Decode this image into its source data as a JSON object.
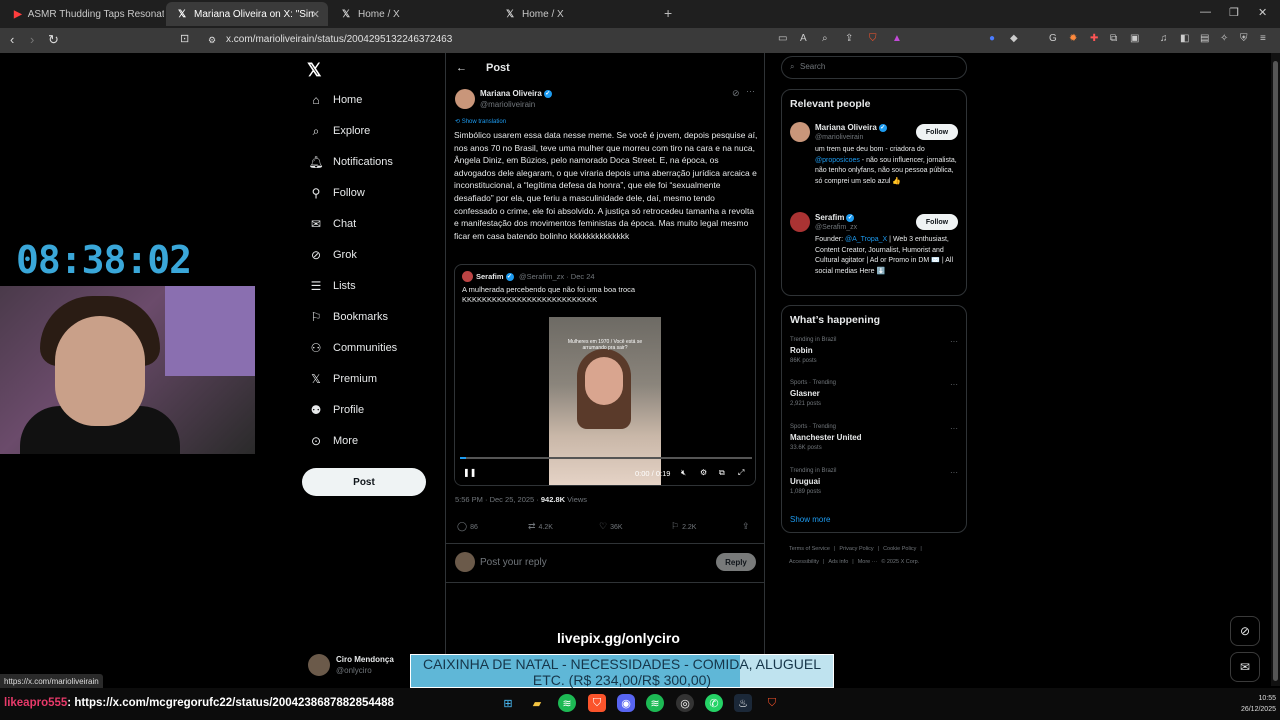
{
  "browser": {
    "tabs": [
      {
        "title": "ASMR Thudding Taps Resonating in",
        "icon": "youtube-icon",
        "active": false
      },
      {
        "title": "Mariana Oliveira on X: \"Simbólic",
        "icon": "x-icon",
        "active": true
      },
      {
        "title": "Home / X",
        "icon": "x-icon",
        "active": false
      },
      {
        "title": "Home / X",
        "icon": "x-icon",
        "active": false
      }
    ],
    "url": "x.com/marioliveirain/status/2004295132246372463",
    "status_url": "https://x.com/marioliveirain"
  },
  "overlay": {
    "clock": "08:38:02",
    "livepix": "livepix.gg/onlyciro",
    "banner_line1": "CAIXINHA DE NATAL - NECESSIDADES - COMIDA, ALUGUEL",
    "banner_line2": "ETC. (R$ 234,00/R$ 300,00)",
    "chat_user": "likeapro555",
    "chat_message": ": https://x.com/mcgregorufc22/status/2004238687882854488"
  },
  "sidebar": {
    "items": [
      {
        "label": "Home",
        "icon": "home-icon"
      },
      {
        "label": "Explore",
        "icon": "search-icon"
      },
      {
        "label": "Notifications",
        "icon": "bell-icon"
      },
      {
        "label": "Follow",
        "icon": "person-plus-icon"
      },
      {
        "label": "Chat",
        "icon": "mail-icon"
      },
      {
        "label": "Grok",
        "icon": "grok-icon"
      },
      {
        "label": "Lists",
        "icon": "list-icon"
      },
      {
        "label": "Bookmarks",
        "icon": "bookmark-icon"
      },
      {
        "label": "Communities",
        "icon": "people-icon"
      },
      {
        "label": "Premium",
        "icon": "x-icon"
      },
      {
        "label": "Profile",
        "icon": "person-icon"
      },
      {
        "label": "More",
        "icon": "more-circle-icon"
      }
    ],
    "post_label": "Post",
    "account_name": "Ciro Mendonça",
    "account_handle": "@onlyciro"
  },
  "post": {
    "header_title": "Post",
    "author_name": "Mariana Oliveira",
    "author_handle": "@marioliveirain",
    "show_translation": "Show translation",
    "text": "Simbólico usarem essa data nesse meme. Se você é jovem, depois pesquise aí, nos anos 70 no Brasil, teve uma mulher que morreu com tiro na cara e na nuca, Ângela Diniz, em Búzios, pelo namorado Doca Street. E, na época, os advogados dele alegaram, o que viraria depois uma aberração jurídica arcaica e inconstitucional, a “legítima defesa da honra”, que ele foi “sexualmente desafiado” por ela, que feriu a masculinidade dele, daí, mesmo tendo confessado o crime, ele foi absolvido. A justiça só retrocedeu tamanha a revolta e manifestação dos movimentos feministas da época. Mas muito legal mesmo ficar em casa batendo bolinho kkkkkkkkkkkkkk",
    "quote": {
      "author_name": "Serafim",
      "author_handle": "@Serafim_zx",
      "date": "Dec 24",
      "text": "A mulherada percebendo que não foi uma boa troca KKKKKKKKKKKKKKKKKKKKKKKKKKK",
      "video_caption": "Mulheres em 1970 / Você está se arrumando pra sair?",
      "video_time": "0:00 / 0:19",
      "progress": 0.02
    },
    "time": "5:56 PM · Dec 25, 2025 · ",
    "views": "942.8K",
    "views_label": " Views",
    "stats": {
      "replies": "86",
      "reposts": "4.2K",
      "likes": "36K",
      "bookmarks": "2.2K"
    },
    "reply_placeholder": "Post your reply",
    "reply_label": "Reply"
  },
  "right": {
    "search_placeholder": "Search",
    "relevant_title": "Relevant people",
    "people": [
      {
        "name": "Mariana Oliveira",
        "handle": "@marioliveirain",
        "bio_pre": "um trem que deu bom - criadora do ",
        "bio_link": "@proposicoes",
        "bio_post": " - não sou influencer, jornalista, não tenho onlyfans, não sou pessoa pública, só comprei um selo azul 👍",
        "follow": "Follow"
      },
      {
        "name": "Serafim",
        "handle": "@Serafim_zx",
        "bio_pre": "Founder: ",
        "bio_link": "@A_Tropa_X",
        "bio_post": " | Web 3 enthusiast, Content Creator, Journalist, Humorist and Cultural agitator | Ad or Promo in DM ✉️ | All social medias Here ⬇️",
        "follow": "Follow"
      }
    ],
    "happening_title": "What’s happening",
    "trends": [
      {
        "context": "Trending in Brazil",
        "title": "Robin",
        "count": "86K posts"
      },
      {
        "context": "Sports · Trending",
        "title": "Glasner",
        "count": "2,921 posts"
      },
      {
        "context": "Sports · Trending",
        "title": "Manchester United",
        "count": "33.6K posts"
      },
      {
        "context": "Trending in Brazil",
        "title": "Uruguai",
        "count": "1,089 posts"
      }
    ],
    "show_more": "Show more",
    "footer": [
      "Terms of Service",
      "|",
      "Privacy Policy",
      "|",
      "Cookie Policy",
      "|",
      "Accessibility",
      "|",
      "Ads info",
      "|",
      "More ···",
      "© 2025 X Corp."
    ]
  },
  "taskbar": {
    "time": "10:55",
    "date": "26/12/2025"
  }
}
